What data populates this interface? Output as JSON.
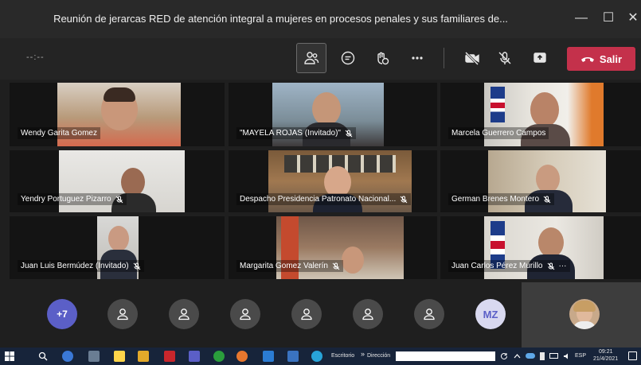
{
  "window": {
    "title": "Reunión de jerarcas RED de atención integral a mujeres en procesos penales y sus familiares de...",
    "minimize": "—",
    "maximize": "☐",
    "close": "✕"
  },
  "toolbar": {
    "timer": "--:--",
    "leave_label": "Salir"
  },
  "participants": [
    {
      "name": "Wendy Garita Gomez",
      "muted": false
    },
    {
      "name": "\"MAYELA ROJAS (Invitado)\"",
      "muted": true
    },
    {
      "name": "Marcela Guerrero Campos",
      "muted": false
    },
    {
      "name": "Yendry Portuguez Pizarro",
      "muted": true
    },
    {
      "name": "Despacho Presidencia Patronato Nacional...",
      "muted": true
    },
    {
      "name": "German Brenes Montero",
      "muted": true
    },
    {
      "name": "Juan Luis Bermúdez (Invitado)",
      "muted": true
    },
    {
      "name": "Margarita Gomez Valerín",
      "muted": true
    },
    {
      "name": "Juan Carlos Pérez Murillo",
      "muted": true,
      "more": "···"
    }
  ],
  "avatar_bar": {
    "overflow_count": "+7",
    "initials": "MZ"
  },
  "taskbar": {
    "desktop_label": "Escritorio",
    "chevron": "»",
    "address_label": "Dirección",
    "language": "ESP",
    "time": "09:21",
    "date": "21/4/2021"
  },
  "colors": {
    "leave_button": "#c4314b",
    "avatar_more": "#5b5fc7",
    "window_bg": "#1f1f1f"
  }
}
